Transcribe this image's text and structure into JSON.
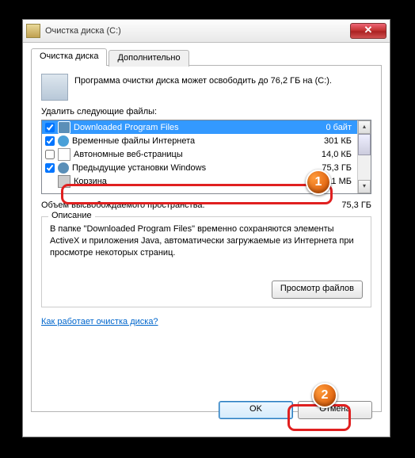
{
  "window": {
    "title": "Очистка диска  (C:)"
  },
  "tabs": {
    "t1": "Очистка диска",
    "t2": "Дополнительно"
  },
  "info_text": "Программа очистки диска может освободить до 76,2 ГБ на  (C:).",
  "delete_label": "Удалить следующие файлы:",
  "files": {
    "r0": {
      "name": "Downloaded Program Files",
      "size": "0 байт"
    },
    "r1": {
      "name": "Временные файлы Интернета",
      "size": "301 КБ"
    },
    "r2": {
      "name": "Автономные веб-страницы",
      "size": "14,0 КБ"
    },
    "r3": {
      "name": "Предыдущие установки Windows",
      "size": "75,3 ГБ"
    },
    "r4": {
      "name": "Корзина",
      "size": "211 МБ"
    }
  },
  "total": {
    "label": "Объем высвобождаемого пространства:",
    "value": "75,3 ГБ"
  },
  "group": {
    "title": "Описание",
    "desc": "В папке \"Downloaded Program Files\" временно сохраняются элементы ActiveX и приложения Java, автоматически загружаемые из Интернета при просмотре некоторых страниц.",
    "view_btn": "Просмотр файлов"
  },
  "link": "Как работает очистка диска?",
  "buttons": {
    "ok": "OK",
    "cancel": "Отмена"
  },
  "annotations": {
    "b1": "1",
    "b2": "2"
  }
}
